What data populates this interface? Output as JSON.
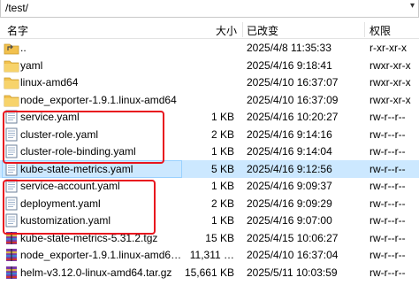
{
  "path": {
    "value": "/test/"
  },
  "columns": {
    "name": "名字",
    "size": "大小",
    "modified": "已改变",
    "permissions": "权限"
  },
  "files": [
    {
      "name": "..",
      "size": "",
      "modified": "2025/4/8 11:35:33",
      "permissions": "r-xr-xr-x",
      "icon": "parent-folder-icon"
    },
    {
      "name": "yaml",
      "size": "",
      "modified": "2025/4/16 9:18:41",
      "permissions": "rwxr-xr-x",
      "icon": "folder-icon"
    },
    {
      "name": "linux-amd64",
      "size": "",
      "modified": "2025/4/10 16:37:07",
      "permissions": "rwxr-xr-x",
      "icon": "folder-icon"
    },
    {
      "name": "node_exporter-1.9.1.linux-amd64",
      "size": "",
      "modified": "2025/4/10 16:37:09",
      "permissions": "rwxr-xr-x",
      "icon": "folder-icon"
    },
    {
      "name": "service.yaml",
      "size": "1 KB",
      "modified": "2025/4/16 10:20:27",
      "permissions": "rw-r--r--",
      "icon": "text-file-icon"
    },
    {
      "name": "cluster-role.yaml",
      "size": "2 KB",
      "modified": "2025/4/16 9:14:16",
      "permissions": "rw-r--r--",
      "icon": "text-file-icon"
    },
    {
      "name": "cluster-role-binding.yaml",
      "size": "1 KB",
      "modified": "2025/4/16 9:14:04",
      "permissions": "rw-r--r--",
      "icon": "text-file-icon"
    },
    {
      "name": "kube-state-metrics.yaml",
      "size": "5 KB",
      "modified": "2025/4/16 9:12:56",
      "permissions": "rw-r--r--",
      "icon": "text-file-icon",
      "selected": true
    },
    {
      "name": "service-account.yaml",
      "size": "1 KB",
      "modified": "2025/4/16 9:09:37",
      "permissions": "rw-r--r--",
      "icon": "text-file-icon"
    },
    {
      "name": "deployment.yaml",
      "size": "2 KB",
      "modified": "2025/4/16 9:09:29",
      "permissions": "rw-r--r--",
      "icon": "text-file-icon"
    },
    {
      "name": "kustomization.yaml",
      "size": "1 KB",
      "modified": "2025/4/16 9:07:00",
      "permissions": "rw-r--r--",
      "icon": "text-file-icon"
    },
    {
      "name": "kube-state-metrics-5.31.2.tgz",
      "size": "15 KB",
      "modified": "2025/4/15 10:06:27",
      "permissions": "rw-r--r--",
      "icon": "archive-icon"
    },
    {
      "name": "node_exporter-1.9.1.linux-amd6…",
      "size": "11,311 …",
      "modified": "2025/4/10 16:37:04",
      "permissions": "rw-r--r--",
      "icon": "archive-icon"
    },
    {
      "name": "helm-v3.12.0-linux-amd64.tar.gz",
      "size": "15,661 KB",
      "modified": "2025/5/11 10:03:59",
      "permissions": "rw-r--r--",
      "icon": "archive-icon"
    }
  ],
  "colors": {
    "highlight": "#e8141e",
    "selection": "#cce8ff",
    "folder": "#f2c14e"
  }
}
